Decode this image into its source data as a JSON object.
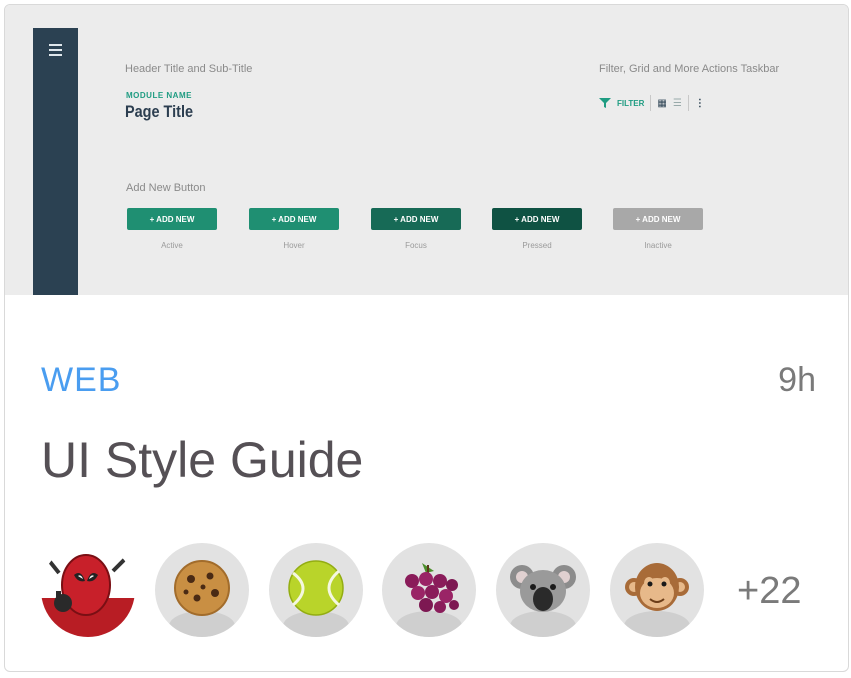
{
  "preview": {
    "header_caption": "Header Title and Sub-Title",
    "module_name": "MODULE NAME",
    "page_title": "Page Title",
    "taskbar_caption": "Filter, Grid and More Actions Taskbar",
    "filter_label": "FILTER",
    "add_new_caption": "Add New Button",
    "buttons": [
      {
        "label": "+ ADD NEW",
        "caption": "Active",
        "color": "#1f8f72"
      },
      {
        "label": "+ ADD NEW",
        "caption": "Hover",
        "color": "#1f8f72"
      },
      {
        "label": "+ ADD NEW",
        "caption": "Focus",
        "color": "#176a56"
      },
      {
        "label": "+ ADD NEW",
        "caption": "Pressed",
        "color": "#0f5243"
      },
      {
        "label": "+ ADD NEW",
        "caption": "Inactive",
        "color": "#a8a8a8"
      }
    ],
    "sidebar_color": "#2b4152"
  },
  "card": {
    "category": "WEB",
    "time": "9h",
    "title": "UI Style Guide",
    "avatars": [
      "deadpool-avatar",
      "cookie-avatar",
      "tennis-ball-avatar",
      "grapes-avatar",
      "koala-avatar",
      "monkey-avatar"
    ],
    "more_count": "+22"
  },
  "colors": {
    "category": "#4a9df0",
    "title": "#555055"
  }
}
